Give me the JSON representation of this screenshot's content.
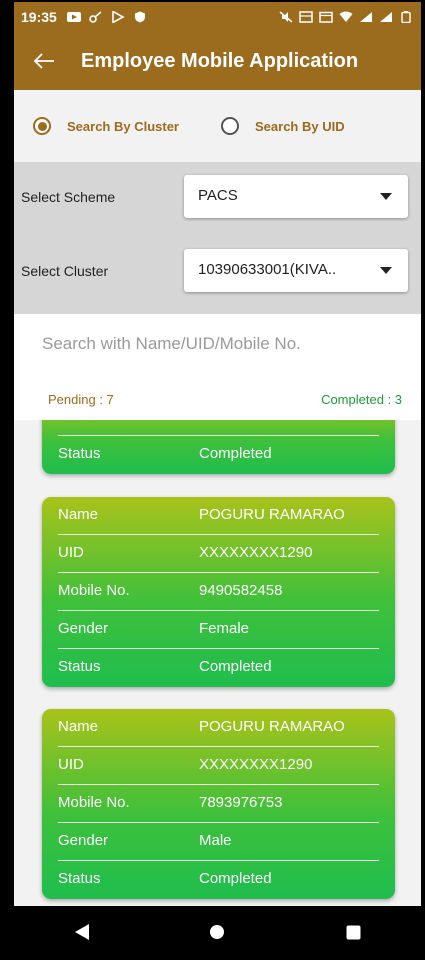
{
  "status_bar": {
    "time": "19:35"
  },
  "app_bar": {
    "title": "Employee Mobile Application"
  },
  "search_mode": {
    "options": [
      {
        "label": "Search By Cluster",
        "checked": true
      },
      {
        "label": "Search By UID",
        "checked": false
      }
    ]
  },
  "filters": {
    "scheme": {
      "label": "Select Scheme",
      "value": "PACS"
    },
    "cluster": {
      "label": "Select Cluster",
      "value": "10390633001(KIVA.."
    }
  },
  "search": {
    "placeholder": "Search with Name/UID/Mobile No."
  },
  "counts": {
    "pending": "Pending : 7",
    "completed": "Completed : 3"
  },
  "field_labels": {
    "name": "Name",
    "uid": "UID",
    "mobile": "Mobile No.",
    "gender": "Gender",
    "status": "Status"
  },
  "cards": [
    {
      "status": "Completed"
    },
    {
      "name": "POGURU RAMARAO",
      "uid": "XXXXXXXX1290",
      "mobile": "9490582458",
      "gender": "Female",
      "status": "Completed"
    },
    {
      "name": "POGURU RAMARAO",
      "uid": "XXXXXXXX1290",
      "mobile": "7893976753",
      "gender": "Male",
      "status": "Completed"
    }
  ],
  "colors": {
    "brand": "#9b6b1e",
    "completed": "#1f9a3c",
    "card_top": "#a9c21a",
    "card_bottom": "#1fbd4e"
  },
  "icons": [
    "back-arrow-icon",
    "caret-down-icon",
    "nav-back-icon",
    "nav-home-icon",
    "nav-recents-icon"
  ]
}
